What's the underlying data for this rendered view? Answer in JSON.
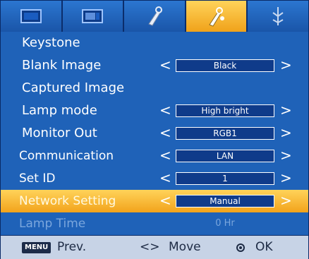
{
  "tabs": [
    {
      "icon": "picture-icon"
    },
    {
      "icon": "screen-icon"
    },
    {
      "icon": "tools-icon"
    },
    {
      "icon": "option-icon",
      "active": true
    },
    {
      "icon": "input-icon"
    }
  ],
  "menu": {
    "rows": [
      {
        "label": "Keystone"
      },
      {
        "label": "Blank Image",
        "value": "Black"
      },
      {
        "label": "Captured Image"
      },
      {
        "label": "Lamp mode",
        "value": "High bright"
      },
      {
        "label": "Monitor Out",
        "value": "RGB1"
      },
      {
        "label": "Communication",
        "value": "LAN"
      },
      {
        "label": "Set ID",
        "value": "1"
      },
      {
        "label": "Network Setting",
        "value": "Manual",
        "selected": true
      },
      {
        "label": "Lamp Time",
        "value": "0 Hr",
        "disabled": true
      }
    ],
    "arrow_left": "<",
    "arrow_right": ">"
  },
  "footer": {
    "menu_key": "MENU",
    "prev": "Prev.",
    "move_symbol": "<>",
    "move": "Move",
    "ok": "OK"
  },
  "colors": {
    "background": "#1f62b8",
    "highlight": "#f4ad24",
    "value_box": "#0f3b8a",
    "footer": "#c7d3e6",
    "disabled_text": "#7aa6dd"
  }
}
